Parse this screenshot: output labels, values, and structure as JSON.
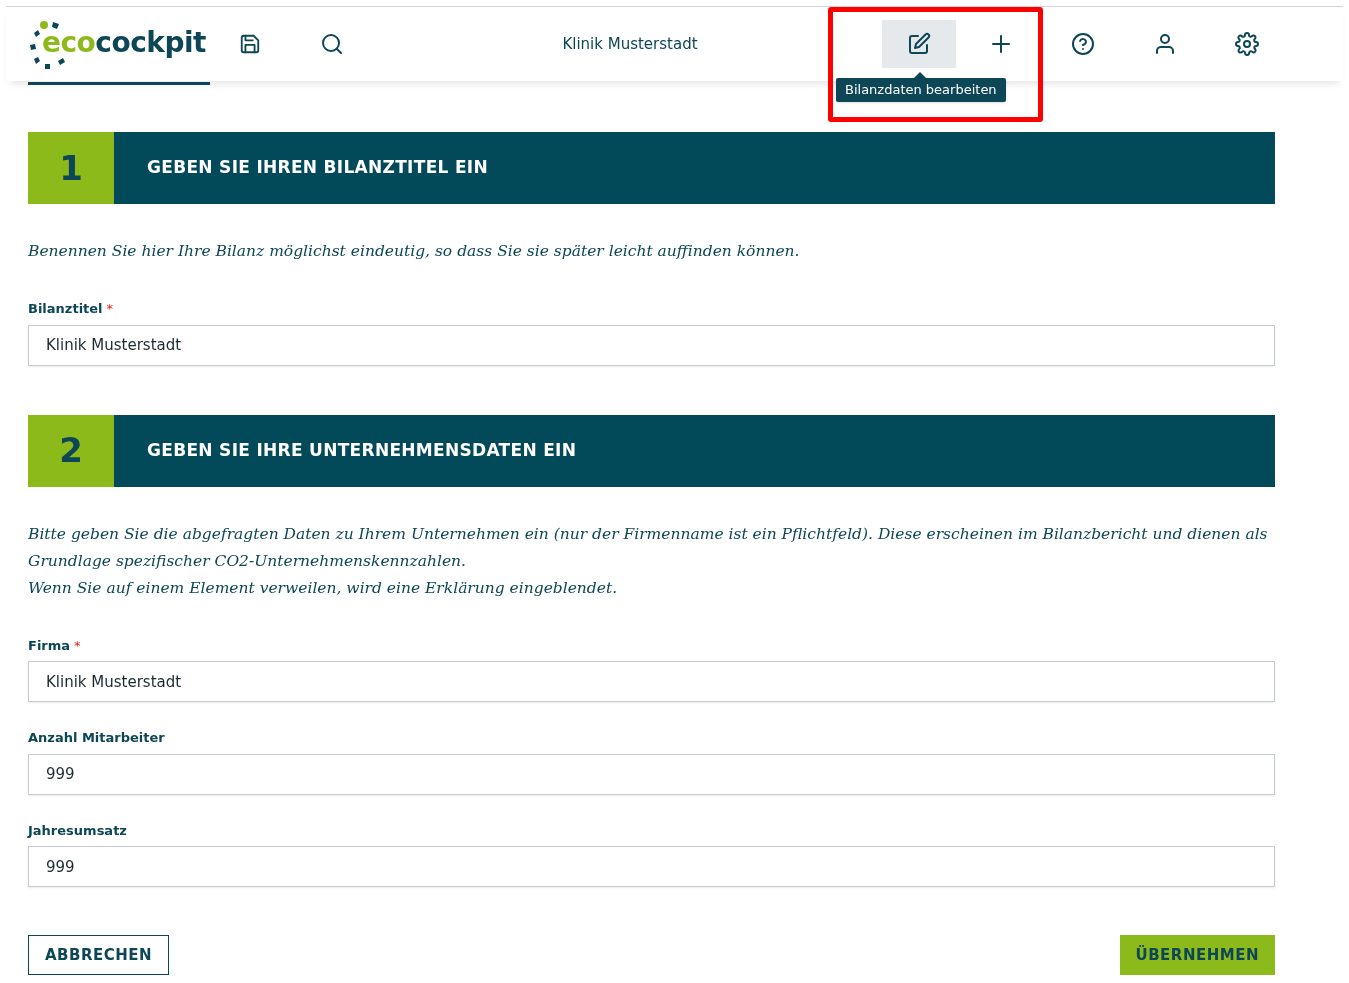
{
  "header": {
    "logo": {
      "part_1": "eco",
      "part_2": "cockpit"
    },
    "title": "Klinik Musterstadt",
    "tools": [
      {
        "kind": "edit",
        "selected": true,
        "tooltip": "Bilanzdaten bearbeiten",
        "highlighted": true
      },
      {
        "kind": "plus",
        "selected": false,
        "highlighted": true
      },
      {
        "kind": "help",
        "selected": false,
        "highlighted": false
      },
      {
        "kind": "user",
        "selected": false,
        "highlighted": false
      },
      {
        "kind": "settings",
        "selected": false,
        "highlighted": false
      }
    ]
  },
  "sections": [
    {
      "number": "1",
      "title": "GEBEN SIE IHREN BILANZTITEL EIN",
      "intro": [
        "Benennen Sie hier Ihre Bilanz möglichst eindeutig, so dass Sie sie später leicht auffinden können."
      ],
      "fields": [
        {
          "label": "Bilanztitel",
          "required_mark": "*",
          "value": "Klinik Musterstadt"
        }
      ]
    },
    {
      "number": "2",
      "title": "GEBEN SIE IHRE UNTERNEHMENSDATEN EIN",
      "intro": [
        "Bitte geben Sie die abgefragten Daten zu Ihrem Unternehmen ein (nur der Firmenname ist ein Pflichtfeld). Diese erscheinen im Bilanzbericht und dienen als Grundlage spezifischer CO2-Unternehmenskennzahlen.",
        "Wenn Sie auf einem Element verweilen, wird eine Erklärung eingeblendet."
      ],
      "fields": [
        {
          "label": "Firma",
          "required_mark": "*",
          "value": "Klinik Musterstadt"
        },
        {
          "label": "Anzahl Mitarbeiter",
          "value": "999"
        },
        {
          "label": "Jahresumsatz",
          "value": "999"
        }
      ]
    }
  ],
  "buttons": {
    "cancel": "ABBRECHEN",
    "submit": "ÜBERNEHMEN"
  }
}
